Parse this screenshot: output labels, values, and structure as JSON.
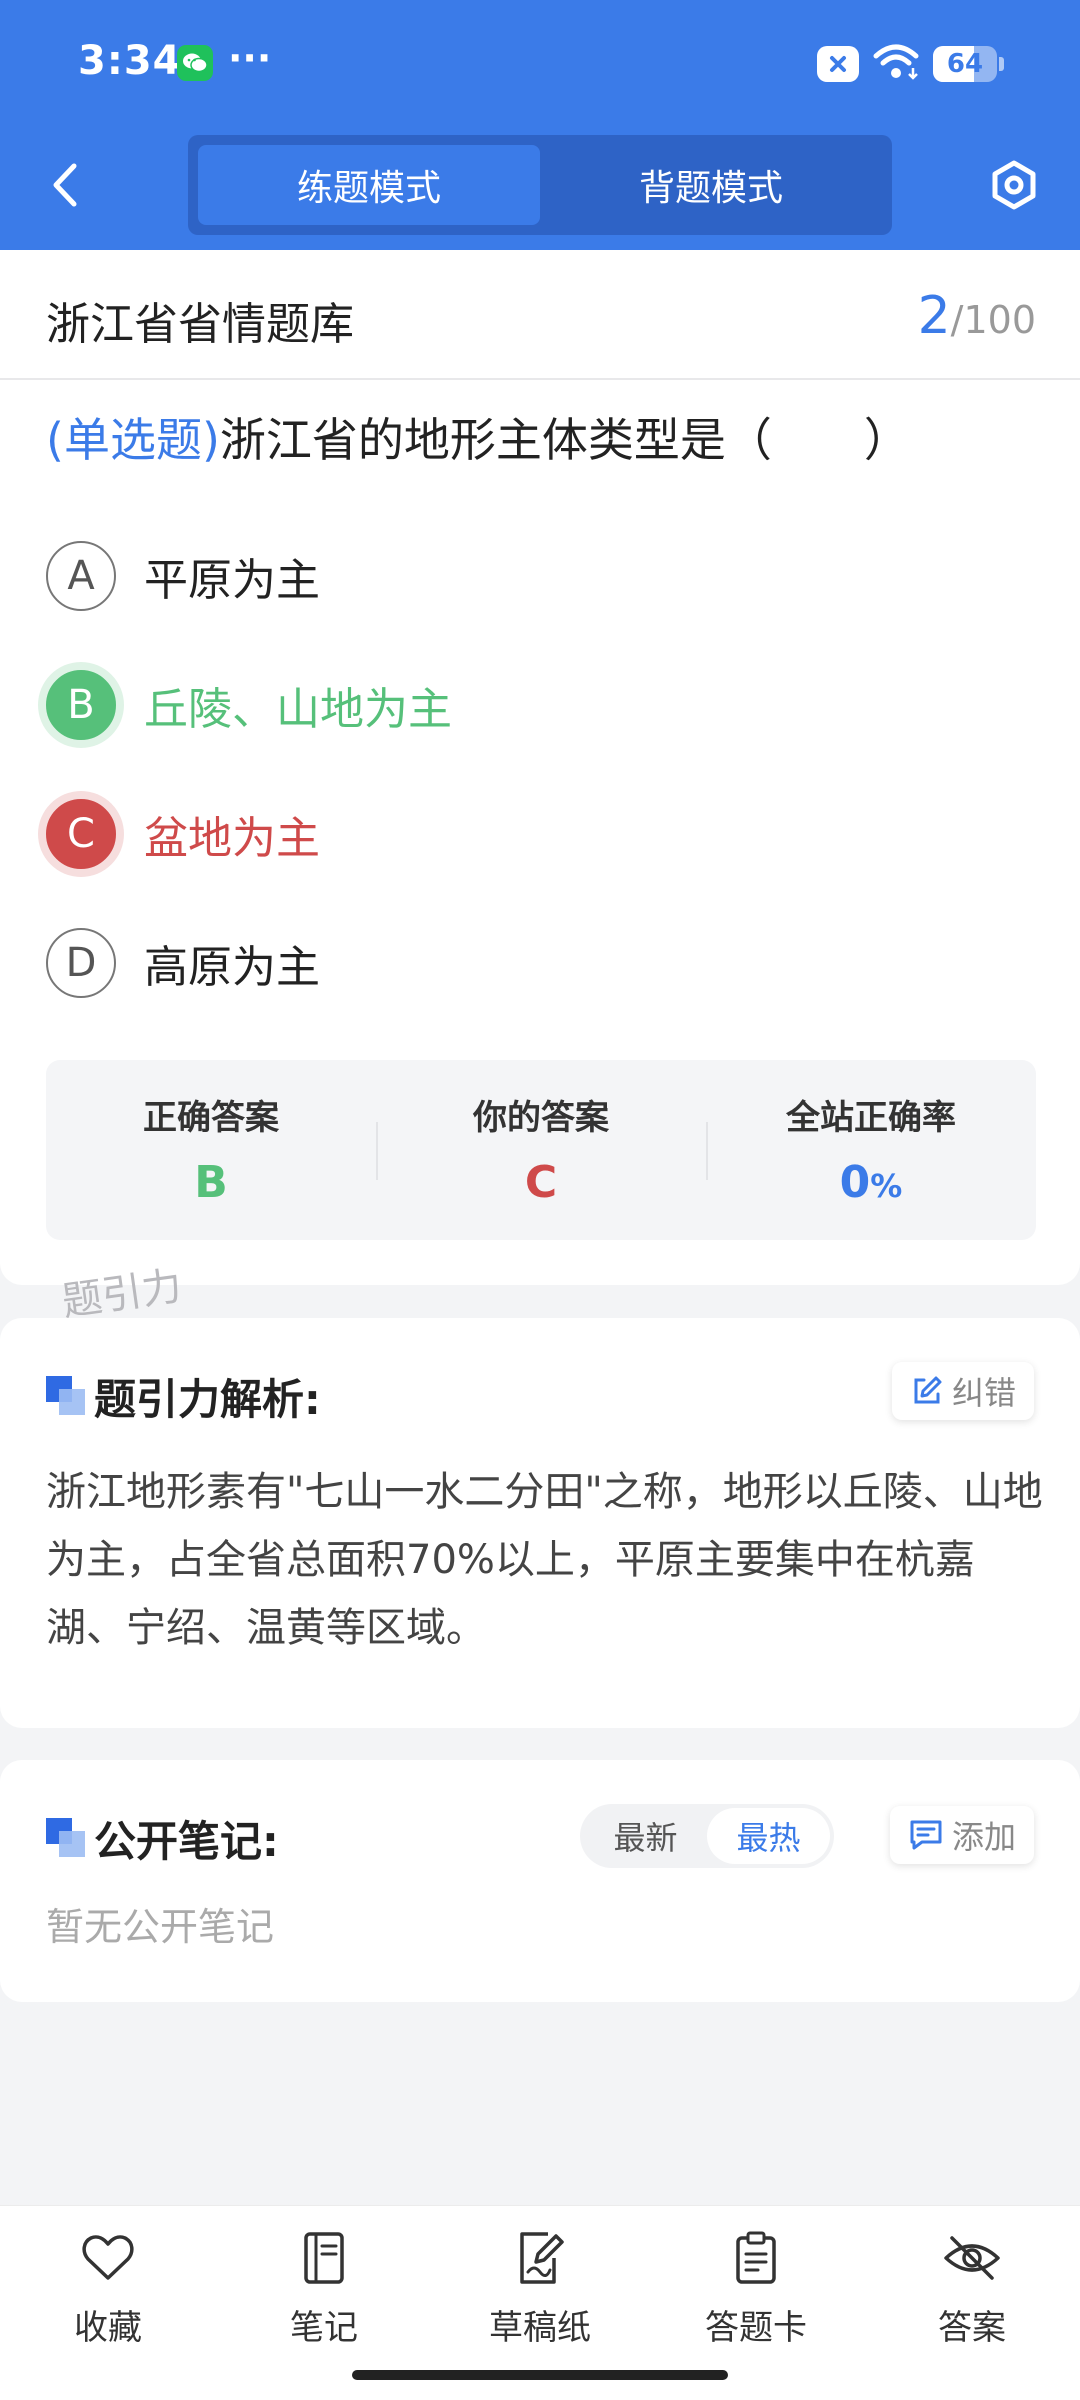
{
  "status_bar": {
    "time": "3:34",
    "more": "···",
    "battery": 64
  },
  "header": {
    "tabs": [
      {
        "label": "练题模式",
        "active": true
      },
      {
        "label": "背题模式",
        "active": false
      }
    ]
  },
  "bank": {
    "title": "浙江省省情题库",
    "current": "2",
    "total": "/100"
  },
  "question": {
    "type_label": "(单选题)",
    "text": "浙江省的地形主体类型是（　　）",
    "options": [
      {
        "letter": "A",
        "text": "平原为主",
        "state": "normal"
      },
      {
        "letter": "B",
        "text": "丘陵、山地为主",
        "state": "correct"
      },
      {
        "letter": "C",
        "text": "盆地为主",
        "state": "wrong"
      },
      {
        "letter": "D",
        "text": "高原为主",
        "state": "normal"
      }
    ]
  },
  "stats": {
    "correct_label": "正确答案",
    "correct_value": "B",
    "yours_label": "你的答案",
    "yours_value": "C",
    "rate_label": "全站正确率",
    "rate_value": "0",
    "rate_unit": "%"
  },
  "watermark": "题引力",
  "analysis": {
    "title": "题引力解析:",
    "report_label": "纠错",
    "text": "浙江地形素有\"七山一水二分田\"之称，地形以丘陵、山地为主，占全省总面积70%以上，平原主要集中在杭嘉湖、宁绍、温黄等区域。"
  },
  "notes": {
    "title": "公开笔记:",
    "sort_options": [
      {
        "label": "最新",
        "active": false
      },
      {
        "label": "最热",
        "active": true
      }
    ],
    "add_label": "添加",
    "empty_text": "暂无公开笔记"
  },
  "bottom_nav": [
    {
      "label": "收藏",
      "icon": "heart-icon"
    },
    {
      "label": "笔记",
      "icon": "notebook-icon"
    },
    {
      "label": "草稿纸",
      "icon": "draft-icon"
    },
    {
      "label": "答题卡",
      "icon": "answer-sheet-icon"
    },
    {
      "label": "答案",
      "icon": "eye-off-icon"
    }
  ],
  "colors": {
    "primary": "#3b7be8",
    "correct": "#56c07a",
    "wrong": "#cf4a4a"
  }
}
